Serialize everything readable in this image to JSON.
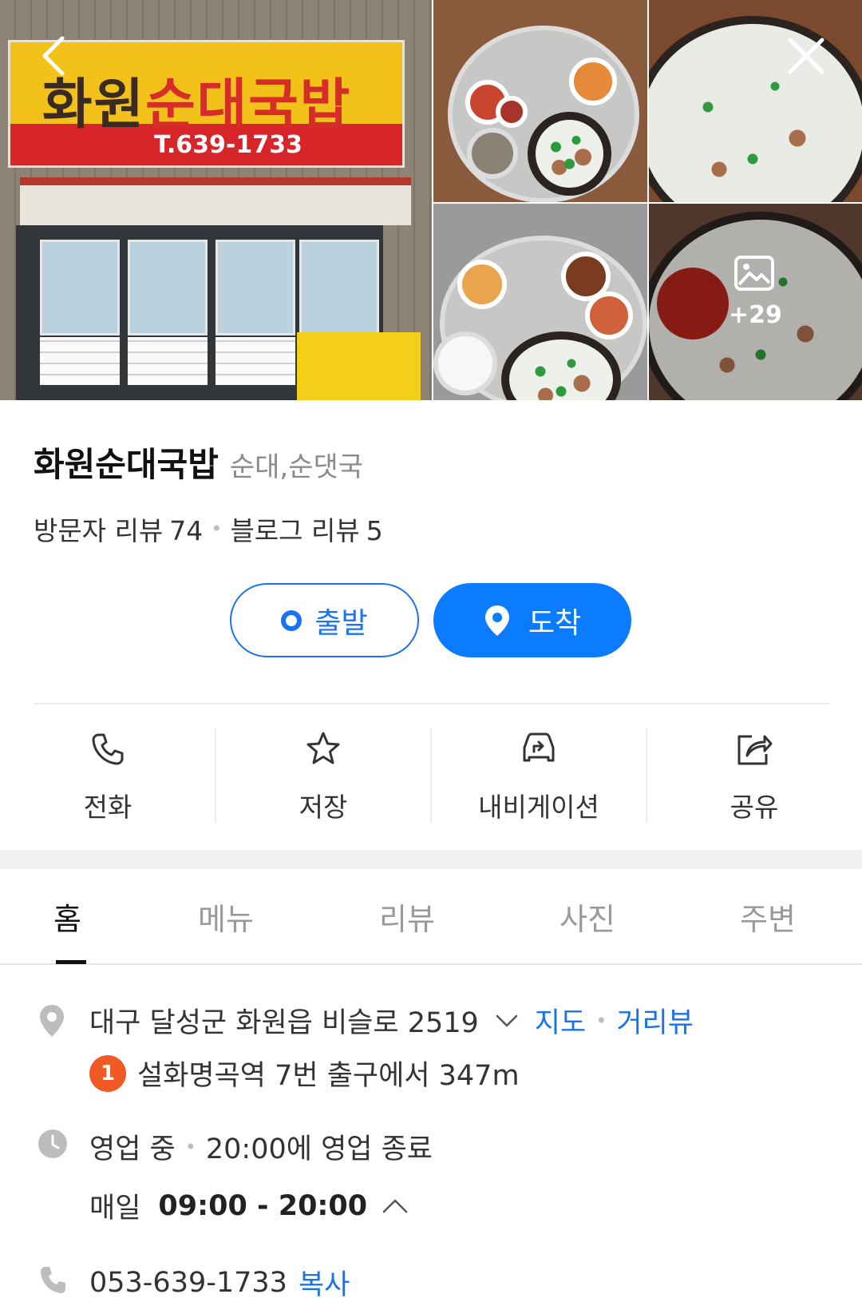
{
  "header": {
    "back_icon": "chevron-left-icon",
    "close_icon": "close-icon",
    "storefront_sign": {
      "name_part1": "화원",
      "name_part2": "순대국밥",
      "tel": "T.639-1733"
    },
    "more_photos_count": "+29"
  },
  "place": {
    "name": "화원순대국밥",
    "category": "순대,순댓국",
    "visitor_review_label": "방문자 리뷰",
    "visitor_review_count": "74",
    "blog_review_label": "블로그 리뷰",
    "blog_review_count": "5"
  },
  "route": {
    "start_label": "출발",
    "arrive_label": "도착"
  },
  "actions": [
    {
      "label": "전화",
      "icon": "phone-icon"
    },
    {
      "label": "저장",
      "icon": "star-icon"
    },
    {
      "label": "내비게이션",
      "icon": "car-navigation-icon"
    },
    {
      "label": "공유",
      "icon": "share-icon"
    }
  ],
  "tabs": [
    {
      "label": "홈",
      "active": true
    },
    {
      "label": "메뉴",
      "active": false
    },
    {
      "label": "리뷰",
      "active": false
    },
    {
      "label": "사진",
      "active": false
    },
    {
      "label": "주변",
      "active": false
    }
  ],
  "info": {
    "address": "대구 달성군 화원읍 비슬로 2519",
    "map_link": "지도",
    "street_view_link": "거리뷰",
    "subway_line": "1",
    "subway_text": "설화명곡역 7번 출구에서 347m",
    "status": "영업 중",
    "closing_text": "20:00에 영업 종료",
    "daily_label": "매일",
    "daily_hours": "09:00 - 20:00",
    "phone": "053-639-1733",
    "copy_label": "복사"
  },
  "colors": {
    "accent_blue": "#0b7bff",
    "link_blue": "#1a73e8",
    "subway_line1_orange": "#f05a24"
  }
}
